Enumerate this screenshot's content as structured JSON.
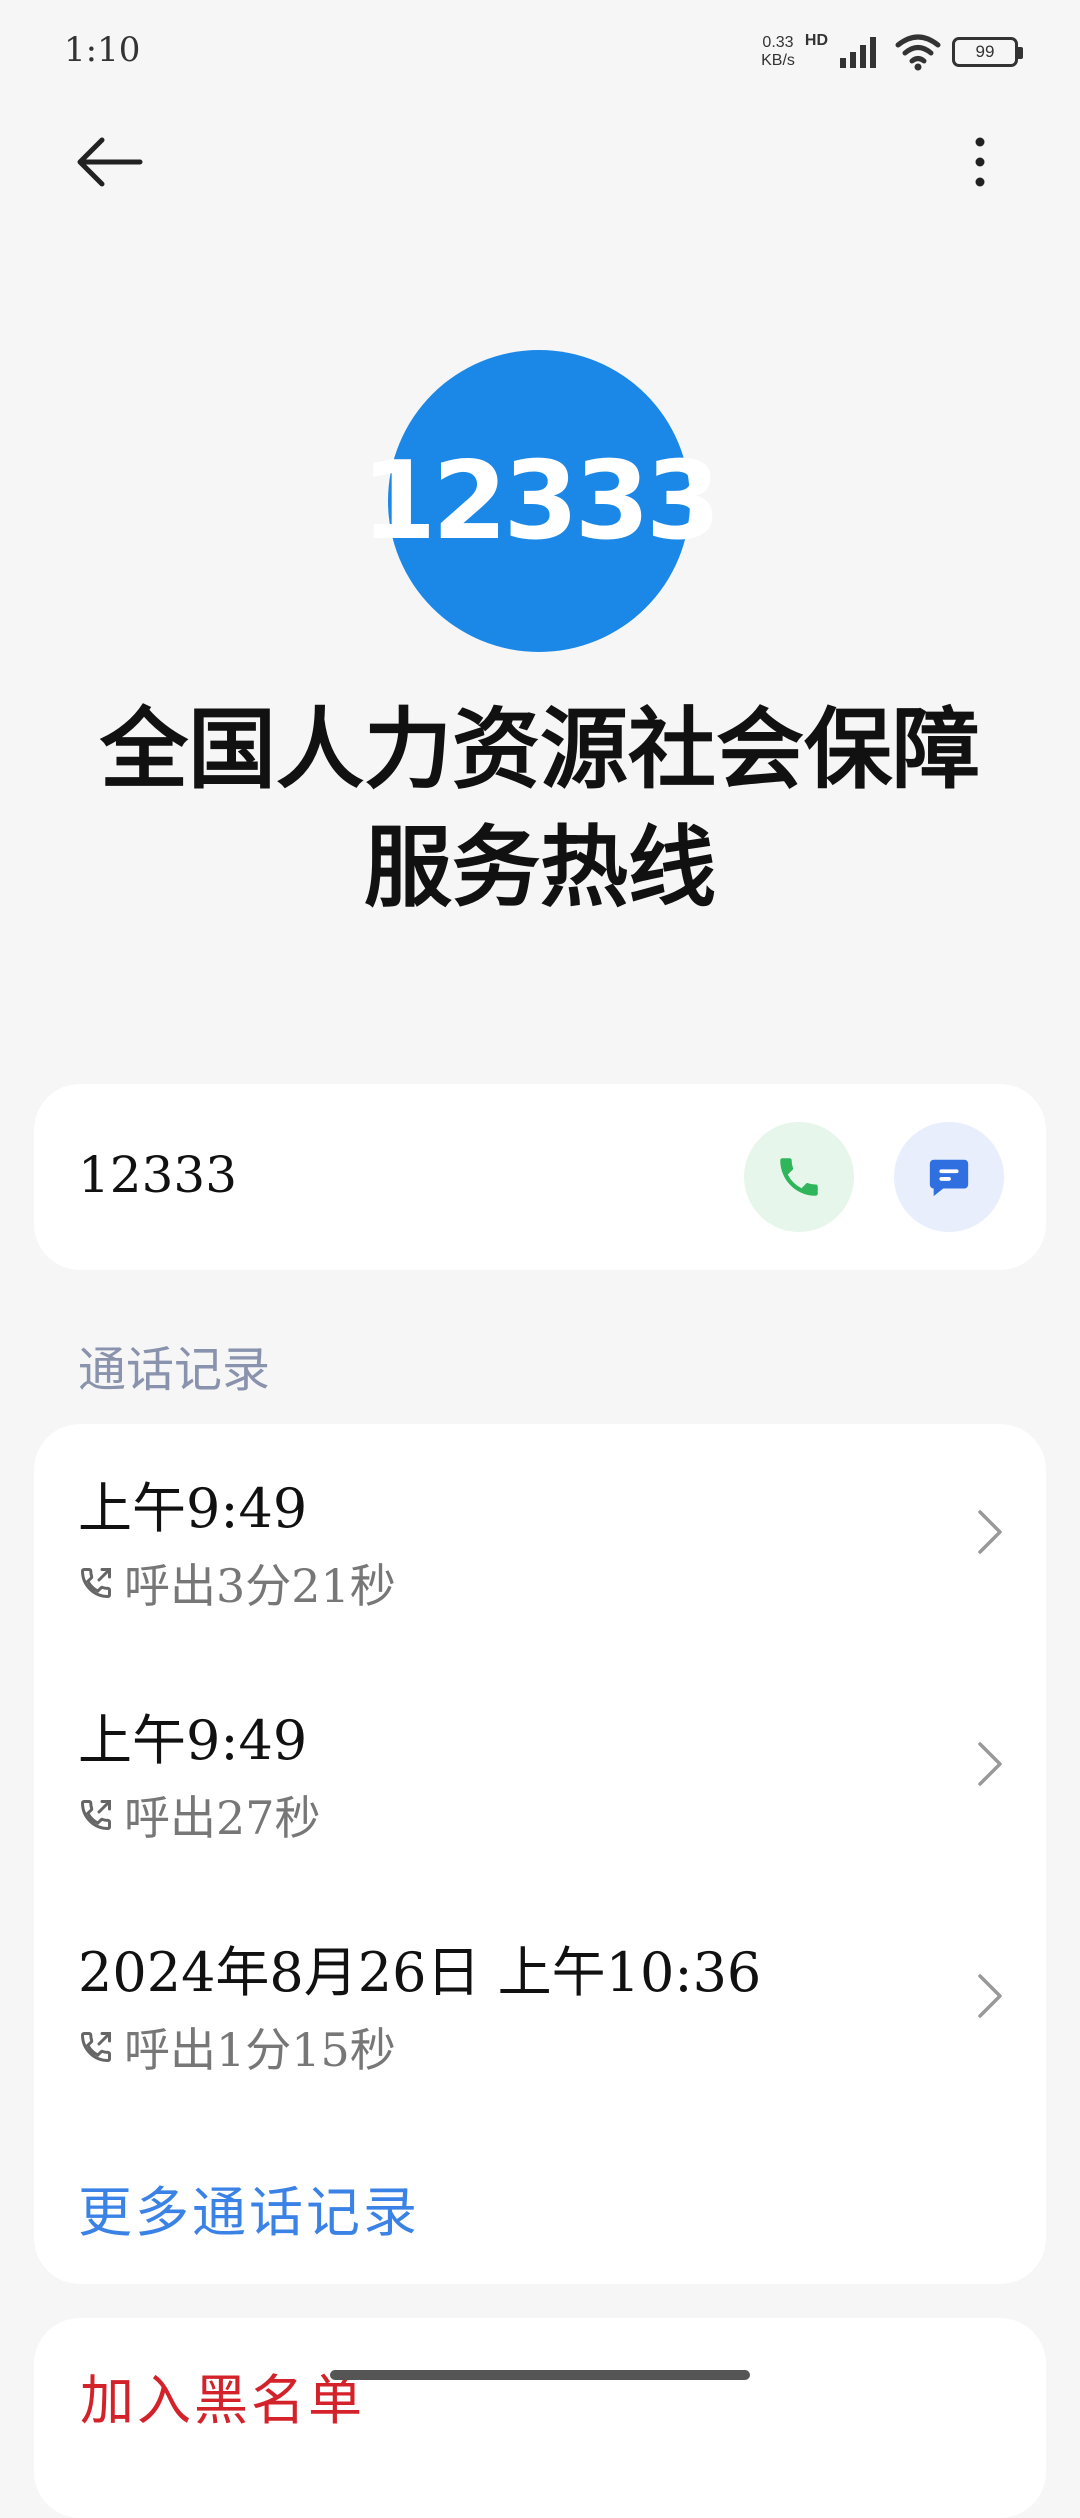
{
  "status_bar": {
    "time": "1:10",
    "net_speed_value": "0.33",
    "net_speed_unit": "KB/s",
    "hd": "HD",
    "battery": "99"
  },
  "header": {
    "back_icon": "arrow-left-icon",
    "more_icon": "more-vertical-icon"
  },
  "contact": {
    "avatar_text": "12333",
    "avatar_color": "#1b88e8",
    "name_line1": "全国人力资源社会保障",
    "name_line2": "服务热线",
    "number": "12333"
  },
  "actions": {
    "call_icon": "phone-icon",
    "message_icon": "message-icon",
    "call_color": "#2fb55a",
    "message_color": "#2f6fe0"
  },
  "call_log": {
    "section_title": "通话记录",
    "items": [
      {
        "time": "上午9:49",
        "detail": "呼出3分21秒"
      },
      {
        "time": "上午9:49",
        "detail": "呼出27秒"
      },
      {
        "time": "2024年8月26日  上午10:36",
        "detail": "呼出1分15秒"
      }
    ],
    "more_link": "更多通话记录"
  },
  "bottom": {
    "blacklist": "加入黑名单"
  }
}
